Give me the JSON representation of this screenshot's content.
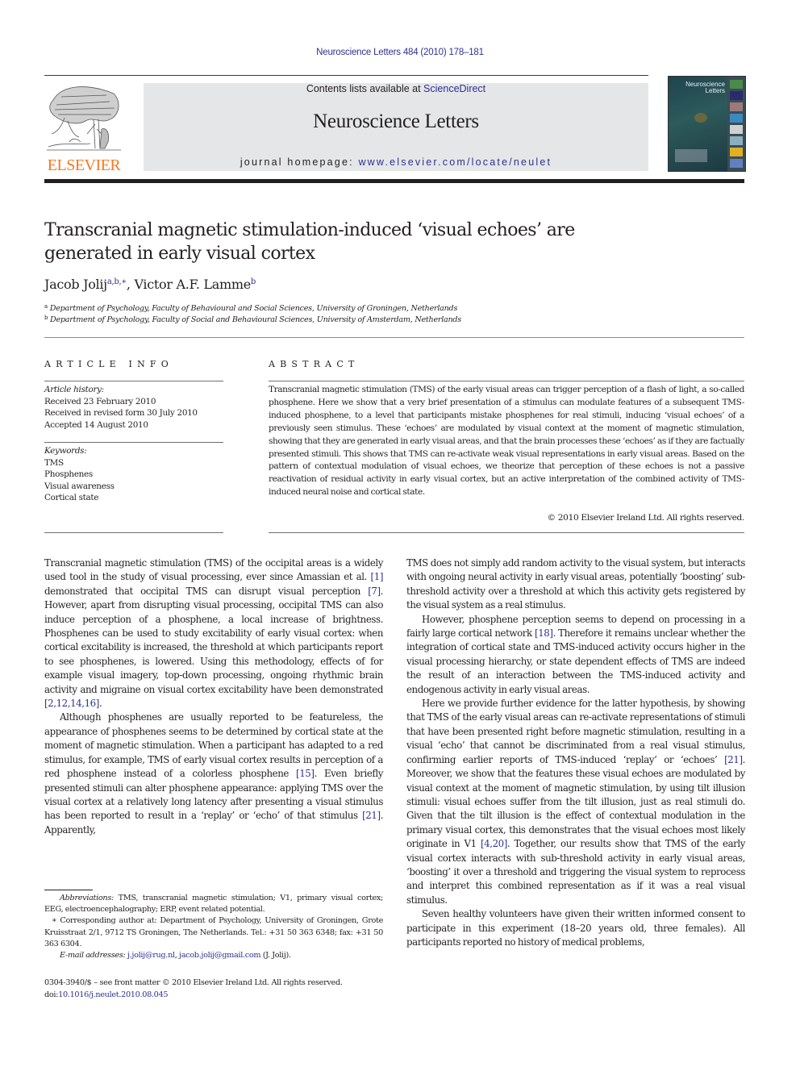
{
  "running_head": "Neuroscience Letters 484 (2010) 178–181",
  "masthead": {
    "publisher_logo_text": "ELSEVIER",
    "contents_prefix": "Contents lists available at ",
    "contents_link": "ScienceDirect",
    "journal_name": "Neuroscience Letters",
    "homepage_prefix": "journal homepage: ",
    "homepage_url": "www.elsevier.com/locate/neulet",
    "cover_title_line1": "Neuroscience",
    "cover_title_line2": "Letters",
    "colors": {
      "link": "#2e3192",
      "logo": "#f47920",
      "banner": "#e5e6e8"
    }
  },
  "article": {
    "title": "Transcranial magnetic stimulation-induced ‘visual echoes’ are generated in early visual cortex",
    "authors": [
      {
        "name": "Jacob Jolij",
        "marks": "a,b,∗",
        "separator": ", "
      },
      {
        "name": "Victor A.F. Lamme",
        "marks": "b",
        "separator": ""
      }
    ],
    "affiliations": [
      {
        "mark": "a",
        "text": "Department of Psychology, Faculty of Behavioural and Social Sciences, University of Groningen, Netherlands"
      },
      {
        "mark": "b",
        "text": "Department of Psychology, Faculty of Social and Behavioural Sciences, University of Amsterdam, Netherlands"
      }
    ]
  },
  "article_info": {
    "heading": "ARTICLE INFO",
    "history_label": "Article history:",
    "history": [
      "Received 23 February 2010",
      "Received in revised form 30 July 2010",
      "Accepted 14 August 2010"
    ],
    "keywords_label": "Keywords:",
    "keywords": [
      "TMS",
      "Phosphenes",
      "Visual awareness",
      "Cortical state"
    ]
  },
  "abstract": {
    "heading": "ABSTRACT",
    "text": "Transcranial magnetic stimulation (TMS) of the early visual areas can trigger perception of a flash of light, a so-called phosphene. Here we show that a very brief presentation of a stimulus can modulate features of a subsequent TMS-induced phosphene, to a level that participants mistake phosphenes for real stimuli, inducing ‘visual echoes’ of a previously seen stimulus. These ‘echoes’ are modulated by visual context at the moment of magnetic stimulation, showing that they are generated in early visual areas, and that the brain processes these ‘echoes’ as if they are factually presented stimuli. This shows that TMS can re-activate weak visual representations in early visual areas. Based on the pattern of contextual modulation of visual echoes, we theorize that perception of these echoes is not a passive reactivation of residual activity in early visual cortex, but an active interpretation of the combined activity of TMS-induced neural noise and cortical state.",
    "copyright": "© 2010 Elsevier Ireland Ltd. All rights reserved."
  },
  "body": {
    "left": [
      {
        "indent": false,
        "segments": [
          {
            "t": "Transcranial magnetic stimulation (TMS) of the occipital areas is a widely used tool in the study of visual processing, ever since Amassian et al. "
          },
          {
            "c": "[1]"
          },
          {
            "t": " demonstrated that occipital TMS can disrupt visual perception "
          },
          {
            "c": "[7]"
          },
          {
            "t": ". However, apart from disrupting visual processing, occipital TMS can also induce perception of a phosphene, a local increase of brightness. Phosphenes can be used to study excitability of early visual cortex: when cortical excitability is increased, the threshold at which participants report to see phosphenes, is lowered. Using this methodology, effects of for example visual imagery, top-down processing, ongoing rhythmic brain activity and migraine on visual cortex excitability have been demonstrated "
          },
          {
            "c": "[2,12,14,16]"
          },
          {
            "t": "."
          }
        ]
      },
      {
        "indent": true,
        "segments": [
          {
            "t": "Although phosphenes are usually reported to be featureless, the appearance of phosphenes seems to be determined by cortical state at the moment of magnetic stimulation. When a participant has adapted to a red stimulus, for example, TMS of early visual cortex results in perception of a red phosphene instead of a colorless phosphene "
          },
          {
            "c": "[15]"
          },
          {
            "t": ". Even briefly presented stimuli can alter phosphene appearance: applying TMS over the visual cortex at a relatively long latency after presenting a visual stimulus has been reported to result in a ‘replay’ or ‘echo’ of that stimulus "
          },
          {
            "c": "[21]"
          },
          {
            "t": ". Apparently,"
          }
        ]
      }
    ],
    "right": [
      {
        "indent": false,
        "segments": [
          {
            "t": "TMS does not simply add random activity to the visual system, but interacts with ongoing neural activity in early visual areas, potentially ‘boosting’ sub-threshold activity over a threshold at which this activity gets registered by the visual system as a real stimulus."
          }
        ]
      },
      {
        "indent": true,
        "segments": [
          {
            "t": "However, phosphene perception seems to depend on processing in a fairly large cortical network "
          },
          {
            "c": "[18]"
          },
          {
            "t": ". Therefore it remains unclear whether the integration of cortical state and TMS-induced activity occurs higher in the visual processing hierarchy, or state dependent effects of TMS are indeed the result of an interaction between the TMS-induced activity and endogenous activity in early visual areas."
          }
        ]
      },
      {
        "indent": true,
        "segments": [
          {
            "t": "Here we provide further evidence for the latter hypothesis, by showing that TMS of the early visual areas can re-activate representations of stimuli that have been presented right before magnetic stimulation, resulting in a visual ‘echo’ that cannot be discriminated from a real visual stimulus, confirming earlier reports of TMS-induced ‘replay’ or ‘echoes’ "
          },
          {
            "c": "[21]"
          },
          {
            "t": ". Moreover, we show that the features these visual echoes are modulated by visual context at the moment of magnetic stimulation, by using tilt illusion stimuli: visual echoes suffer from the tilt illusion, just as real stimuli do. Given that the tilt illusion is the effect of contextual modulation in the primary visual cortex, this demonstrates that the visual echoes most likely originate in V1 "
          },
          {
            "c": "[4,20]"
          },
          {
            "t": ". Together, our results show that TMS of the early visual cortex interacts with sub-threshold activity in early visual areas, ‘boosting’ it over a threshold and triggering the visual system to reprocess and interpret this combined representation as if it was a real visual stimulus."
          }
        ]
      },
      {
        "indent": true,
        "segments": [
          {
            "t": "Seven healthy volunteers have given their written informed consent to participate in this experiment (18–20 years old, three females). All participants reported no history of medical problems,"
          }
        ]
      }
    ]
  },
  "footnotes": {
    "abbreviations_label": "Abbreviations:",
    "abbreviations_text": "  TMS, transcranial magnetic stimulation; V1, primary visual cortex; EEG, electroencephalography; ERP, event related potential.",
    "corresponding": "∗ Corresponding author at: Department of Psychology, University of Groningen, Grote Kruisstraat 2/1, 9712 TS Groningen, The Netherlands. Tel.: +31 50 363 6348; fax: +31 50 363 6304.",
    "email_label": "E-mail addresses:",
    "emails": [
      "j.jolij@rug.nl",
      "jacob.jolij@gmail.com"
    ],
    "email_owner": "(J. Jolij)."
  },
  "front_matter": {
    "issn_line": "0304-3940/$ – see front matter © 2010 Elsevier Ireland Ltd. All rights reserved.",
    "doi_prefix": "doi:",
    "doi": "10.1016/j.neulet.2010.08.045"
  }
}
